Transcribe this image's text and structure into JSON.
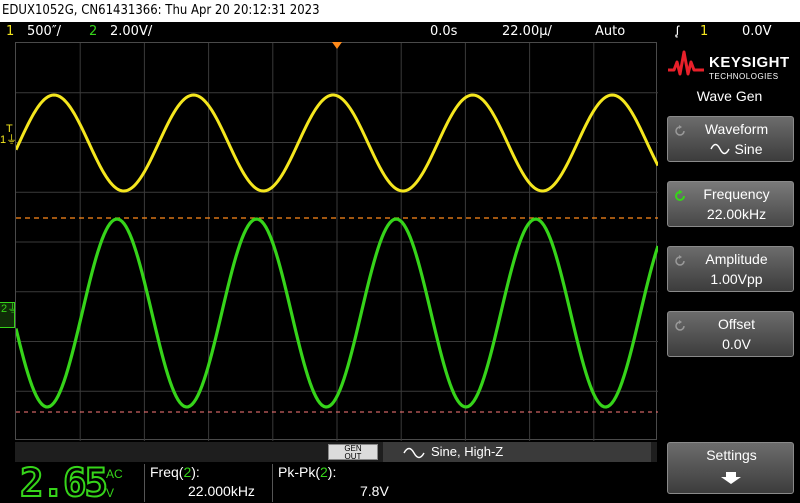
{
  "title": "EDUX1052G, CN61431366: Thu Apr 20 20:12:31 2023",
  "status": {
    "ch1_num": "1",
    "ch1_scale": "500″/",
    "ch2_num": "2",
    "ch2_scale": "2.00V/",
    "time_pos": "0.0s",
    "time_scale": "22.00µ/",
    "trigger_mode": "Auto",
    "trigger_ch": "1",
    "trigger_level": "0.0V"
  },
  "markers": {
    "ch1": "1",
    "ch2": "2",
    "trigger_t": "T"
  },
  "bottom": {
    "gen_out_1": "GEN",
    "gen_out_2": "OUT",
    "wave_desc": "Sine, High-Z"
  },
  "measurements": {
    "big_value": "2.65",
    "big_unit_top": "AC",
    "big_unit_bottom": "V",
    "freq_label": "Freq(2):",
    "freq_value": "22.000kHz",
    "pkpk_label": "Pk-Pk(2):",
    "pkpk_value": "7.8V"
  },
  "softkeys": {
    "logo_main": "KEYSIGHT",
    "logo_sub": "TECHNOLOGIES",
    "menu_title": "Wave Gen",
    "waveform_title": "Waveform",
    "waveform_value": "Sine",
    "frequency_title": "Frequency",
    "frequency_value": "22.00kHz",
    "amplitude_title": "Amplitude",
    "amplitude_value": "1.00Vpp",
    "offset_title": "Offset",
    "offset_value": "0.0V",
    "settings_title": "Settings"
  },
  "colors": {
    "ch1": "#f4e61e",
    "ch2": "#36d41a",
    "trigger": "#ff8a1a",
    "grid": "#3a3a3a"
  },
  "signals": {
    "ch1_periods_on_screen": 4.6,
    "ch2_periods_on_screen": 4.6
  }
}
